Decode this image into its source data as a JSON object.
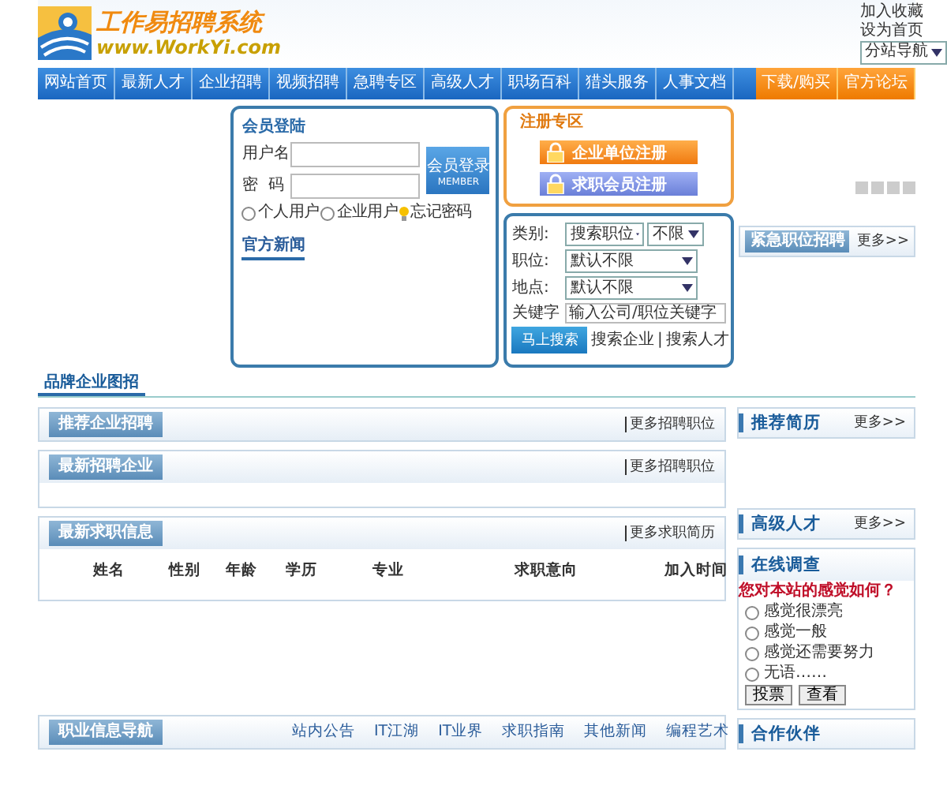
{
  "header": {
    "logo_title": "工作易招聘系统",
    "logo_url": "www.WorkYi.com",
    "links": [
      "加入收藏",
      "设为首页"
    ],
    "site_select": "分站导航"
  },
  "nav": {
    "items": [
      {
        "label": "网站首页",
        "kind": "main"
      },
      {
        "label": "最新人才",
        "kind": "main"
      },
      {
        "label": "企业招聘",
        "kind": "main"
      },
      {
        "label": "视频招聘",
        "kind": "main"
      },
      {
        "label": "急聘专区",
        "kind": "main"
      },
      {
        "label": "高级人才",
        "kind": "main"
      },
      {
        "label": "职场百科",
        "kind": "main"
      },
      {
        "label": "猎头服务",
        "kind": "main"
      },
      {
        "label": "人事文档",
        "kind": "main"
      },
      {
        "label": "下载/购买",
        "kind": "extra"
      },
      {
        "label": "官方论坛",
        "kind": "extra"
      }
    ]
  },
  "login": {
    "title": "会员登陆",
    "username_label": "用户名",
    "password_label": "密  码",
    "button": "会员登录",
    "button_sub": "MEMBER",
    "roles": [
      {
        "label": "个人用户",
        "selected": false
      },
      {
        "label": "企业用户",
        "selected": false
      }
    ],
    "forgot": "忘记密码",
    "news_tab": "官方新闻"
  },
  "register": {
    "title": "注册专区",
    "buttons": [
      {
        "label": "企业单位注册",
        "kind": "company"
      },
      {
        "label": "求职会员注册",
        "kind": "member"
      }
    ]
  },
  "search": {
    "rows": [
      {
        "label": "类别:",
        "kind": "double",
        "value": "搜索职位",
        "value2": "不限"
      },
      {
        "label": "职位:",
        "kind": "single",
        "value": "默认不限"
      },
      {
        "label": "地点:",
        "kind": "single",
        "value": "默认不限"
      },
      {
        "label": "关键字",
        "kind": "input",
        "placeholder": "输入公司/职位关键字"
      }
    ],
    "button": "马上搜索",
    "links": [
      "搜索企业",
      "搜索人才"
    ],
    "separator": "|"
  },
  "urgent": {
    "title": "紧急职位招聘",
    "more": "更多>>"
  },
  "brand_heading": "品牌企业图招",
  "panels": [
    {
      "title": "推荐企业招聘",
      "more": "更多招聘职位",
      "kind": "short"
    },
    {
      "title": "最新招聘企业",
      "more": "更多招聘职位",
      "kind": "tall"
    },
    {
      "title": "最新求职信息",
      "more": "更多求职简历",
      "kind": "table",
      "columns": [
        "姓名",
        "性别",
        "年龄",
        "学历",
        "专业",
        "求职意向",
        "加入时间"
      ]
    }
  ],
  "career_nav": {
    "title": "职业信息导航",
    "links": [
      "站内公告",
      "IT江湖",
      "IT业界",
      "求职指南",
      "其他新闻",
      "编程艺术"
    ]
  },
  "side": {
    "resume": {
      "title": "推荐简历",
      "more": "更多>>"
    },
    "talent": {
      "title": "高级人才",
      "more": "更多>>"
    },
    "survey": {
      "title": "在线调查",
      "question": "您对本站的感觉如何？",
      "options": [
        {
          "label": "感觉很漂亮",
          "selected": false
        },
        {
          "label": "感觉一般",
          "selected": false
        },
        {
          "label": "感觉还需要努力",
          "selected": false
        },
        {
          "label": "无语……",
          "selected": false
        }
      ],
      "buttons": [
        "投票",
        "查看"
      ]
    },
    "partners": {
      "title": "合作伙伴"
    }
  }
}
